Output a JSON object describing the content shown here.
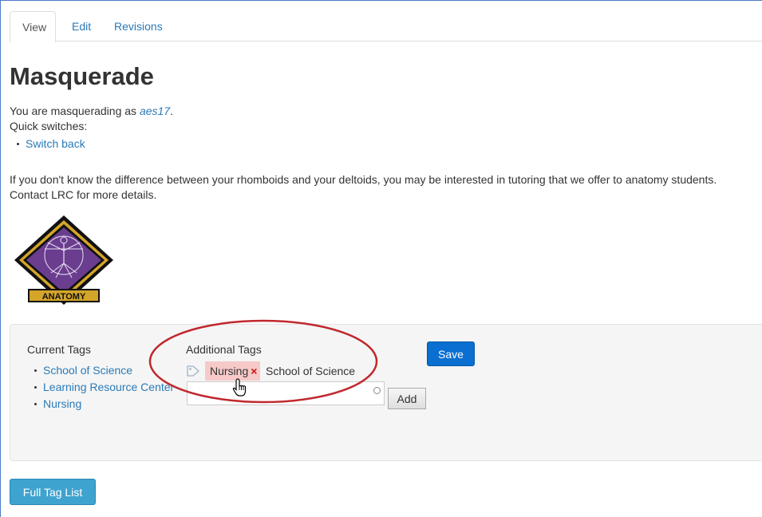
{
  "tabs": [
    {
      "label": "View",
      "active": true
    },
    {
      "label": "Edit",
      "active": false
    },
    {
      "label": "Revisions",
      "active": false
    }
  ],
  "page": {
    "title": "Masquerade",
    "masquerade_prefix": "You are masquerading as ",
    "masquerade_user": "aes17",
    "masquerade_suffix": ".",
    "quick_switches_label": "Quick switches:",
    "switch_back": "Switch back",
    "info_line1": "If you don't know the difference between your rhomboids and your deltoids, you may be interested in tutoring that we offer to anatomy students.",
    "info_line2": "Contact LRC for more details."
  },
  "logo": {
    "text": "ANATOMY",
    "purple": "#6a3d8f",
    "gold": "#d4a52a"
  },
  "tags": {
    "current_heading": "Current Tags",
    "current": [
      "School of Science",
      "Learning Resource Center",
      "Nursing"
    ],
    "additional_heading": "Additional Tags",
    "chip_label": "Nursing",
    "chip_remove": "×",
    "suggestion_text": "School of Science",
    "input_value": "",
    "add_label": "Add",
    "save_label": "Save"
  },
  "full_tag_list_label": "Full Tag List",
  "colors": {
    "link": "#2a7ab8",
    "annotation": "#c0282d",
    "save": "#0a6fd0",
    "full_list": "#3fa3cf"
  }
}
